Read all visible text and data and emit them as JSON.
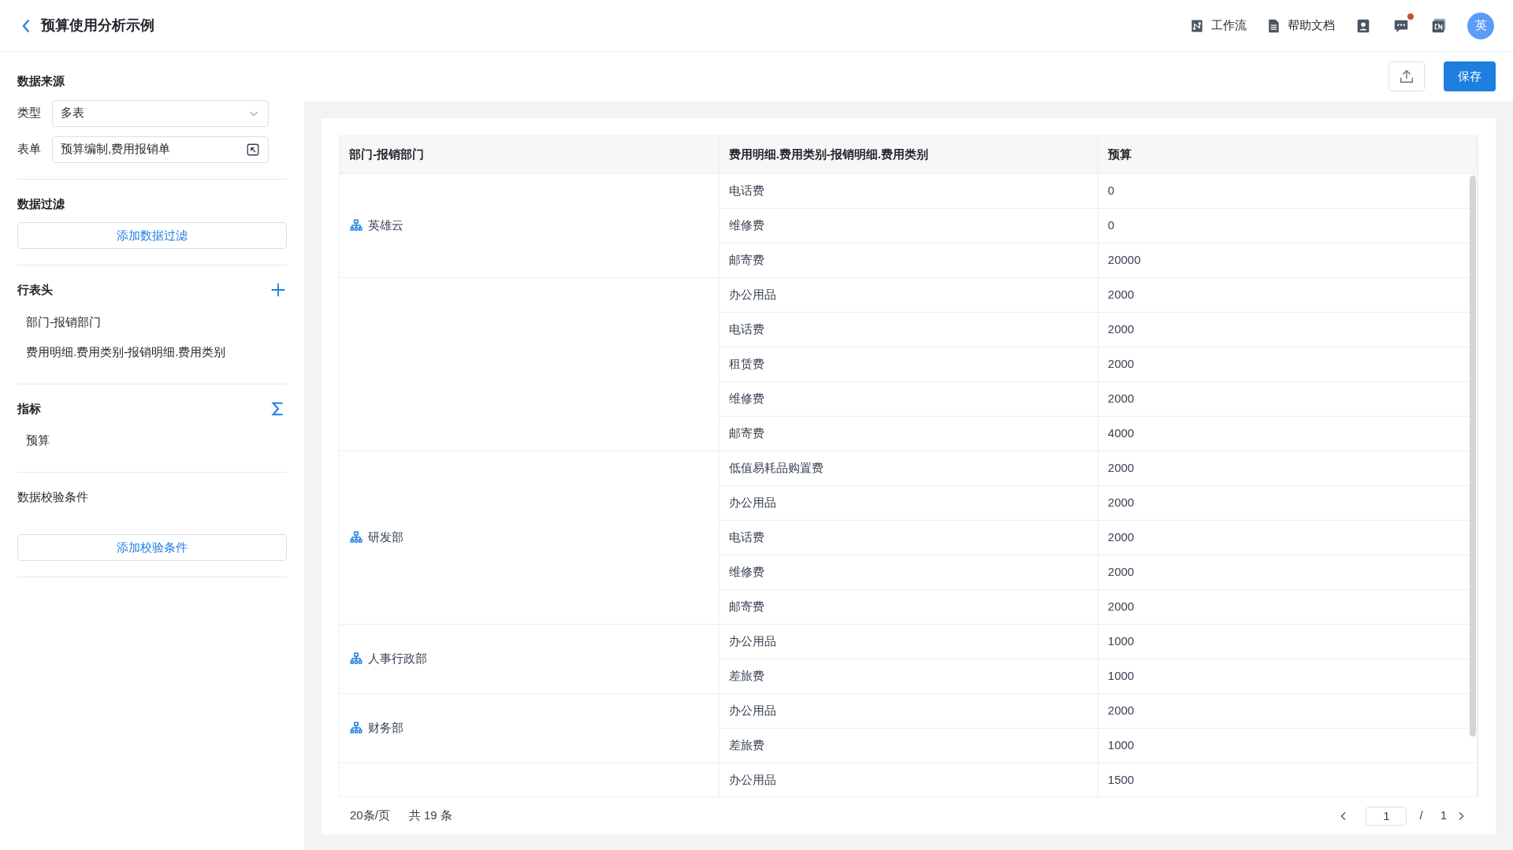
{
  "header": {
    "title": "预算使用分析示例",
    "links": [
      {
        "kind": "workflow",
        "label": "工作流"
      },
      {
        "kind": "docs",
        "label": "帮助文档"
      }
    ],
    "icons": [
      {
        "kind": "contacts"
      },
      {
        "kind": "chat",
        "badge": true
      },
      {
        "kind": "lang"
      }
    ],
    "avatar": "英"
  },
  "toolbar": {
    "save": "保存"
  },
  "sidebar": {
    "source": {
      "title": "数据来源",
      "type_label": "类型",
      "type_value": "多表",
      "form_label": "表单",
      "form_value": "预算编制,费用报销单"
    },
    "filter": {
      "title": "数据过滤",
      "button": "添加数据过滤"
    },
    "rows": {
      "title": "行表头",
      "items": [
        "部门-报销部门",
        "费用明细.费用类别-报销明细.费用类别"
      ]
    },
    "metrics": {
      "title": "指标",
      "items": [
        "预算"
      ]
    },
    "validation": {
      "title": "数据校验条件",
      "button": "添加校验条件"
    }
  },
  "table": {
    "columns": [
      "部门-报销部门",
      "费用明细.费用类别-报销明细.费用类别",
      "预算"
    ],
    "groups": [
      {
        "name": "英雄云",
        "rows": [
          [
            "电话费",
            "0"
          ],
          [
            "维修费",
            "0"
          ],
          [
            "邮寄费",
            "20000"
          ]
        ]
      },
      {
        "rows": [
          [
            "办公用品",
            "2000"
          ],
          [
            "电话费",
            "2000"
          ],
          [
            "租赁费",
            "2000"
          ],
          [
            "维修费",
            "2000"
          ],
          [
            "邮寄费",
            "4000"
          ]
        ]
      },
      {
        "name": "研发部",
        "rows": [
          [
            "低值易耗品购置费",
            "2000"
          ],
          [
            "办公用品",
            "2000"
          ],
          [
            "电话费",
            "2000"
          ],
          [
            "维修费",
            "2000"
          ],
          [
            "邮寄费",
            "2000"
          ]
        ]
      },
      {
        "name": "人事行政部",
        "rows": [
          [
            "办公用品",
            "1000"
          ],
          [
            "差旅费",
            "1000"
          ]
        ]
      },
      {
        "name": "财务部",
        "rows": [
          [
            "办公用品",
            "2000"
          ],
          [
            "差旅费",
            "1000"
          ]
        ]
      },
      {
        "rows": [
          [
            "办公用品",
            "1500"
          ]
        ]
      }
    ]
  },
  "pagination": {
    "page_size": "20条/页",
    "total": "共 19 条",
    "page": "1",
    "separator": "/",
    "pages": "1"
  }
}
